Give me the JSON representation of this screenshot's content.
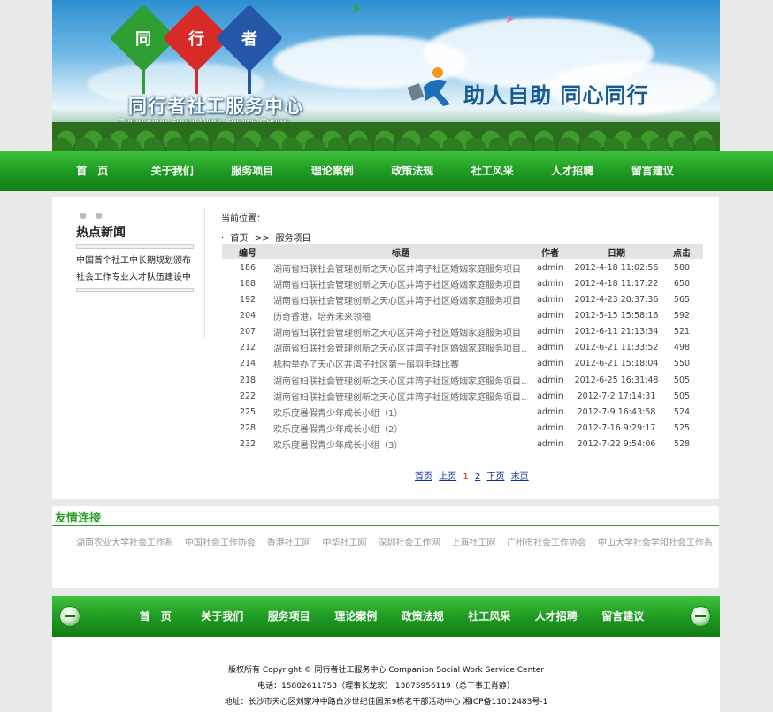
{
  "banner": {
    "kites": [
      {
        "char": "同",
        "color": "#2f9e33"
      },
      {
        "char": "行",
        "color": "#d92a2a"
      },
      {
        "char": "者",
        "color": "#2457a8"
      }
    ],
    "logo_cn": "同行者社工服务中心",
    "logo_en": "Companion Social Work Service Center",
    "slogan": "助人自助  同心同行"
  },
  "nav": [
    "首　页",
    "关于我们",
    "服务项目",
    "理论案例",
    "政策法规",
    "社工风采",
    "人才招聘",
    "留言建议"
  ],
  "sidebar": {
    "title": "热点新闻",
    "items": [
      "中国首个社工中长期规划颁布 …",
      "社会工作专业人才队伍建设中 …"
    ]
  },
  "main": {
    "location_label": "当前位置：",
    "breadcrumb": [
      "首页",
      ">>",
      "服务项目"
    ],
    "columns": [
      "编号",
      "标题",
      "作者",
      "日期",
      "点击"
    ],
    "rows": [
      [
        "186",
        "湖南省妇联社会管理创新之天心区井湾子社区婚姻家庭服务项目",
        "admin",
        "2012-4-18 11:02:56",
        "580"
      ],
      [
        "188",
        "湖南省妇联社会管理创新之天心区井湾子社区婚姻家庭服务项目",
        "admin",
        "2012-4-18 11:17:22",
        "650"
      ],
      [
        "192",
        "湖南省妇联社会管理创新之天心区井湾子社区婚姻家庭服务项目",
        "admin",
        "2012-4-23 20:37:36",
        "565"
      ],
      [
        "204",
        "历奇香港，培养未来领袖",
        "admin",
        "2012-5-15 15:58:16",
        "592"
      ],
      [
        "207",
        "湖南省妇联社会管理创新之天心区井湾子社区婚姻家庭服务项目",
        "admin",
        "2012-6-11 21:13:34",
        "521"
      ],
      [
        "212",
        "湖南省妇联社会管理创新之天心区井湾子社区婚姻家庭服务项目…",
        "admin",
        "2012-6-21 11:33:52",
        "498"
      ],
      [
        "214",
        "机构举办了天心区井湾子社区第一届羽毛球比赛",
        "admin",
        "2012-6-21 15:18:04",
        "550"
      ],
      [
        "218",
        "湖南省妇联社会管理创新之天心区井湾子社区婚姻家庭服务项目…",
        "admin",
        "2012-6-25 16:31:48",
        "505"
      ],
      [
        "222",
        "湖南省妇联社会管理创新之天心区井湾子社区婚姻家庭服务项目…",
        "admin",
        "2012-7-2 17:14:31",
        "505"
      ],
      [
        "225",
        "欢乐度暑假青少年成长小组（1）",
        "admin",
        "2012-7-9 16:43:58",
        "524"
      ],
      [
        "228",
        "欢乐度暑假青少年成长小组（2）",
        "admin",
        "2012-7-16 9:29:17",
        "525"
      ],
      [
        "232",
        "欢乐度暑假青少年成长小组（3）",
        "admin",
        "2012-7-22 9:54:06",
        "528"
      ]
    ],
    "pager": {
      "first": "首页",
      "prev": "上页",
      "p1": "1",
      "p2": "2",
      "next": "下页",
      "last": "末页"
    }
  },
  "links": {
    "title": "友情连接",
    "items": [
      "湖南农业大学社会工作系",
      "中国社会工作协会",
      "香港社工网",
      "中华社工网",
      "深圳社会工作网",
      "上海社工网",
      "广州市社会工作协会",
      "中山大学社会学和社会工作系"
    ]
  },
  "footer": {
    "line1": "版权所有 Copyright © 同行者社工服务中心 Companion Social Work Service Center",
    "line2": "电话：15802611753（理事长龙欢）  13875956119（总干事王肖静）",
    "line3": "地址：长沙市天心区刘家冲中路白沙世纪佳园东9栋老干部活动中心   湘ICP备11012483号-1"
  }
}
